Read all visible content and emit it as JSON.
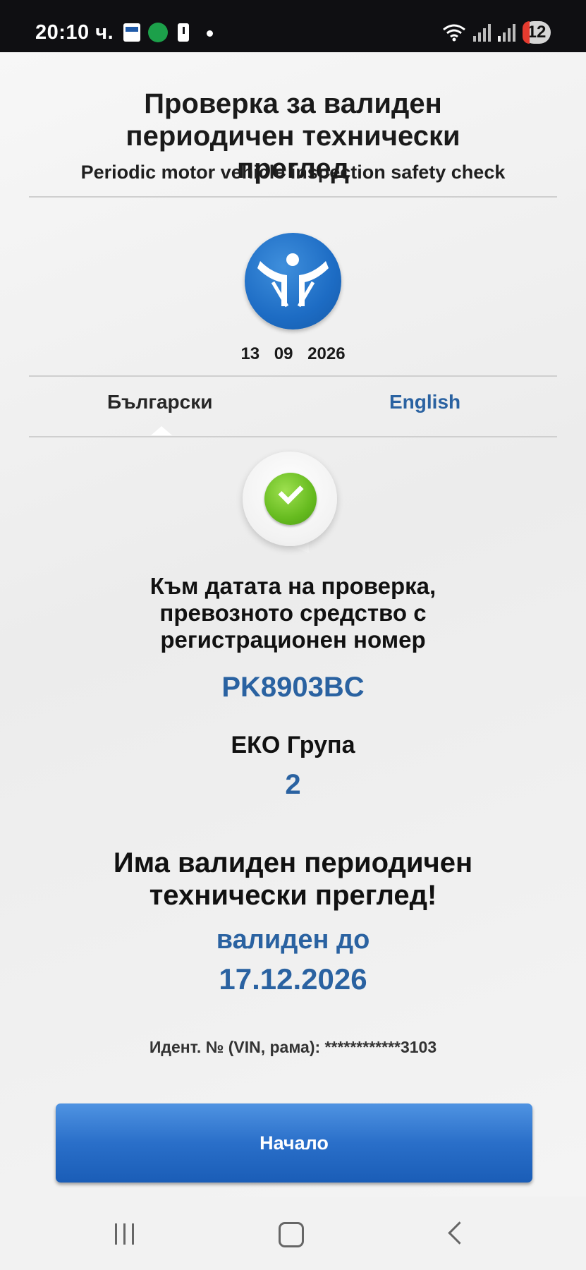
{
  "status_bar": {
    "time": "20:10 ч.",
    "notification_count": "12",
    "icons": [
      "bank-app-icon",
      "tollpass-app-icon",
      "battery-alert-icon",
      "dot-icon",
      "wifi-icon",
      "signal-icon",
      "signal-icon"
    ]
  },
  "header": {
    "title": "Проверка за валиден периодичен технически преглед",
    "subtitle": "Periodic motor vehicle inspection safety check"
  },
  "logo_icon": "inspection-logo-icon",
  "date": "13 09 2026",
  "tabs": [
    {
      "label": "Български",
      "active": true
    },
    {
      "label": "English",
      "active": false
    }
  ],
  "result": {
    "icon": "check-icon",
    "message": "Към датата на проверка, превозното средство с регистрационен номер",
    "plate": "PK8903BC",
    "eco_group_label": "ЕКО Група",
    "eco_group_value": "2",
    "valid_message": "Има валиден периодичен технически преглед!",
    "valid_until_label": "валиден до",
    "valid_until_date": "17.12.2026",
    "vin": "Идент. № (VIN, рама): ************3103"
  },
  "home_button": "Начало",
  "colors": {
    "accent_blue": "#2a62a1",
    "button_blue": "#2a6fc9",
    "check_green": "#66bb1f"
  }
}
